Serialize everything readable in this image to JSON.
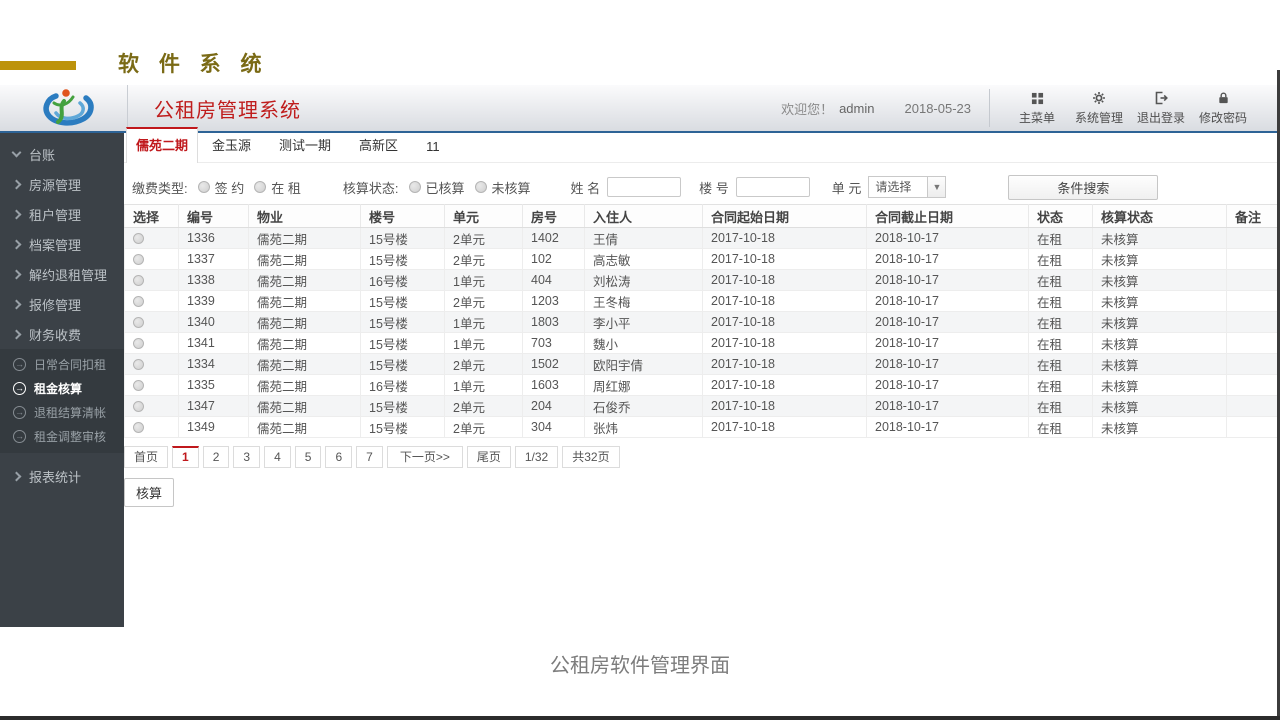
{
  "masthead": {
    "title": "软 件 系 统"
  },
  "header": {
    "app_title": "公租房管理系统",
    "welcome": "欢迎您！",
    "username": "admin",
    "date": "2018-05-23",
    "menu": [
      {
        "label": "主菜单",
        "icon": "grid-icon"
      },
      {
        "label": "系统管理",
        "icon": "gear-icon"
      },
      {
        "label": "退出登录",
        "icon": "logout-icon"
      },
      {
        "label": "修改密码",
        "icon": "lock-icon"
      }
    ]
  },
  "sidebar": {
    "items": [
      {
        "label": "台账"
      },
      {
        "label": "房源管理"
      },
      {
        "label": "租户管理"
      },
      {
        "label": "档案管理"
      },
      {
        "label": "解约退租管理"
      },
      {
        "label": "报修管理"
      },
      {
        "label": "财务收费"
      },
      {
        "label": "日常合同扣租"
      },
      {
        "label": "租金核算"
      },
      {
        "label": "退租结算清帐"
      },
      {
        "label": "租金调整审核"
      },
      {
        "label": "报表统计"
      }
    ]
  },
  "tabs": [
    {
      "label": "儒苑二期"
    },
    {
      "label": "金玉源"
    },
    {
      "label": "测试一期"
    },
    {
      "label": "高新区"
    },
    {
      "label": "11"
    }
  ],
  "filters": {
    "payment_type_label": "缴费类型:",
    "payment_options": [
      "签 约",
      "在 租"
    ],
    "audit_status_label": "核算状态:",
    "audit_options": [
      "已核算",
      "未核算"
    ],
    "name_label": "姓 名",
    "building_label": "楼 号",
    "unit_label": "单 元",
    "unit_select_value": "请选择",
    "search_button": "条件搜索"
  },
  "table": {
    "columns": [
      "选择",
      "编号",
      "物业",
      "楼号",
      "单元",
      "房号",
      "入住人",
      "合同起始日期",
      "合同截止日期",
      "状态",
      "核算状态",
      "备注"
    ],
    "rows": [
      [
        "1336",
        "儒苑二期",
        "15号楼",
        "2单元",
        "1402",
        "王倩",
        "2017-10-18",
        "2018-10-17",
        "在租",
        "未核算",
        ""
      ],
      [
        "1337",
        "儒苑二期",
        "15号楼",
        "2单元",
        "102",
        "高志敏",
        "2017-10-18",
        "2018-10-17",
        "在租",
        "未核算",
        ""
      ],
      [
        "1338",
        "儒苑二期",
        "16号楼",
        "1单元",
        "404",
        "刘松涛",
        "2017-10-18",
        "2018-10-17",
        "在租",
        "未核算",
        ""
      ],
      [
        "1339",
        "儒苑二期",
        "15号楼",
        "2单元",
        "1203",
        "王冬梅",
        "2017-10-18",
        "2018-10-17",
        "在租",
        "未核算",
        ""
      ],
      [
        "1340",
        "儒苑二期",
        "15号楼",
        "1单元",
        "1803",
        "李小平",
        "2017-10-18",
        "2018-10-17",
        "在租",
        "未核算",
        ""
      ],
      [
        "1341",
        "儒苑二期",
        "15号楼",
        "1单元",
        "703",
        "魏小",
        "2017-10-18",
        "2018-10-17",
        "在租",
        "未核算",
        ""
      ],
      [
        "1334",
        "儒苑二期",
        "15号楼",
        "2单元",
        "1502",
        "欧阳宇倩",
        "2017-10-18",
        "2018-10-17",
        "在租",
        "未核算",
        ""
      ],
      [
        "1335",
        "儒苑二期",
        "16号楼",
        "1单元",
        "1603",
        "周红娜",
        "2017-10-18",
        "2018-10-17",
        "在租",
        "未核算",
        ""
      ],
      [
        "1347",
        "儒苑二期",
        "15号楼",
        "2单元",
        "204",
        "石俊乔",
        "2017-10-18",
        "2018-10-17",
        "在租",
        "未核算",
        ""
      ],
      [
        "1349",
        "儒苑二期",
        "15号楼",
        "2单元",
        "304",
        "张炜",
        "2017-10-18",
        "2018-10-17",
        "在租",
        "未核算",
        ""
      ]
    ]
  },
  "pagination": {
    "first_label": "首页",
    "pages": [
      "1",
      "2",
      "3",
      "4",
      "5",
      "6",
      "7"
    ],
    "active_page": "1",
    "next_label": "下一页>>",
    "last_label": "尾页",
    "indicator": "1/32",
    "total_label": "共32页"
  },
  "actions": {
    "verify_label": "核算"
  },
  "caption": "公租房软件管理界面",
  "icons": {
    "dropdown_arrow": "▼",
    "sub_arrow": "→"
  },
  "colors": {
    "accent_red": "#c0181c",
    "header_border_blue": "#2d6396",
    "sidebar_bg": "#3b4147",
    "gold_bar": "#bd930b"
  }
}
